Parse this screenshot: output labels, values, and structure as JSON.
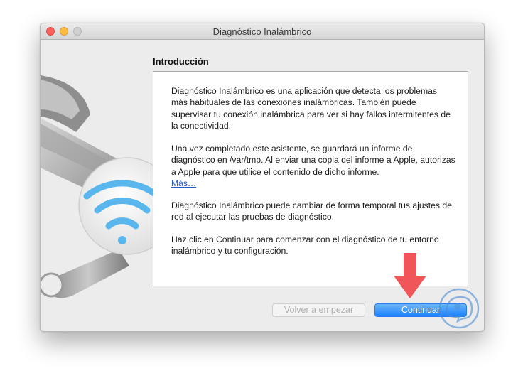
{
  "window": {
    "title": "Diagnóstico Inalámbrico"
  },
  "section": {
    "title": "Introducción"
  },
  "content": {
    "paragraph1": "Diagnóstico Inalámbrico es una aplicación que detecta los problemas más habituales de las conexiones inalámbricas. También puede supervisar tu conexión inalámbrica para ver si hay fallos intermitentes de la conectividad.",
    "paragraph2": "Una vez completado este asistente, se guardará un informe de diagnóstico en /var/tmp. Al enviar una copia del informe a Apple, autorizas a Apple para que utilice el contenido de dicho informe.",
    "more_link": "Más…",
    "paragraph3": "Diagnóstico Inalámbrico puede cambiar de forma temporal tus ajustes de red al ejecutar las pruebas de diagnóstico.",
    "paragraph4": "Haz clic en Continuar para comenzar con el diagnóstico de tu entorno inalámbrico y tu configuración."
  },
  "buttons": {
    "back_label": "Volver a empezar",
    "continue_label": "Continuar"
  },
  "icons": {
    "app_icon": "wireless-diagnostics-icon",
    "wifi": "wifi-icon",
    "annotation_arrow": "red-down-arrow",
    "watermark": "solvetic-logo"
  },
  "colors": {
    "accent": "#1a82fb",
    "close": "#fc605c",
    "minimize": "#fdbc40",
    "arrow": "#f0555a",
    "wifi": "#5ab7ee"
  }
}
